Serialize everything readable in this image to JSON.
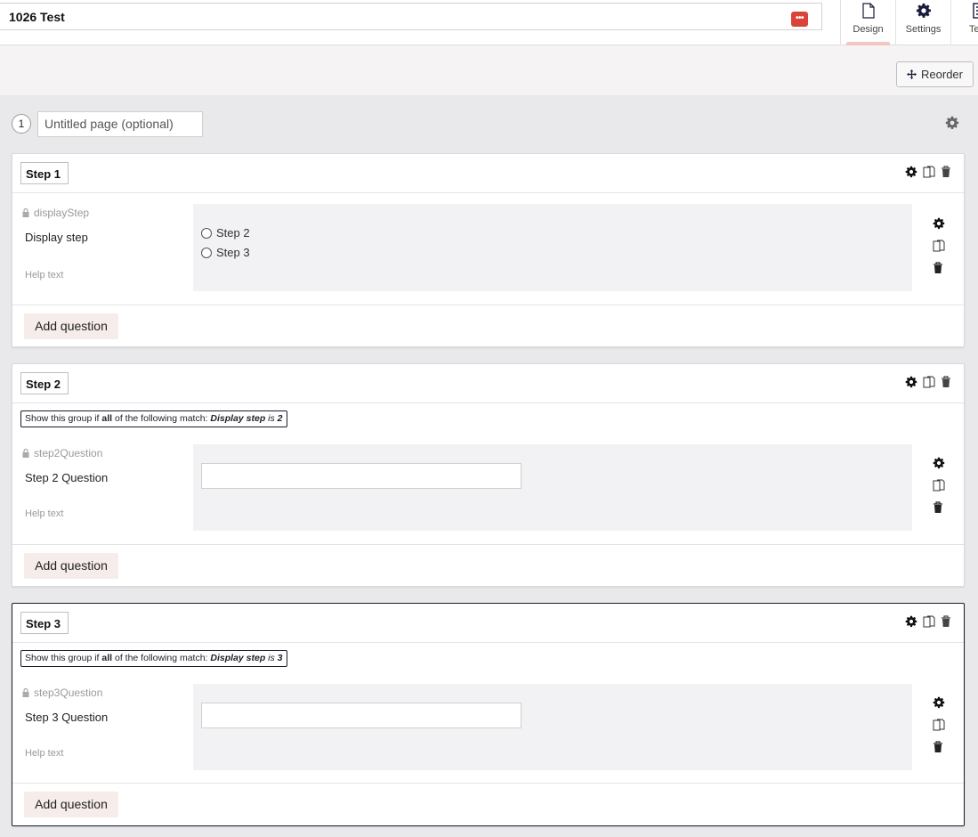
{
  "header": {
    "form_title": "1026 Test",
    "tabs": [
      {
        "label": "Design",
        "icon": "document-icon",
        "active": true
      },
      {
        "label": "Settings",
        "icon": "gear-icon",
        "active": false
      },
      {
        "label": "Test",
        "icon": "test-icon",
        "active": false
      }
    ]
  },
  "toolbar": {
    "reorder_label": "Reorder"
  },
  "page": {
    "number": "1",
    "title_placeholder": "Untitled page (optional)"
  },
  "groups": [
    {
      "name": "Step 1",
      "condition": null,
      "question": {
        "key": "displayStep",
        "label": "Display step",
        "help": "Help text",
        "type": "radio",
        "options": [
          "Step 2",
          "Step 3"
        ]
      },
      "add_label": "Add question"
    },
    {
      "name": "Step 2",
      "condition": {
        "prefix": "Show this group if ",
        "keyword": "all",
        "middle": " of the following match: ",
        "field": "Display step",
        "op": " is ",
        "value": "2"
      },
      "question": {
        "key": "step2Question",
        "label": "Step 2 Question",
        "help": "Help text",
        "type": "text"
      },
      "add_label": "Add question"
    },
    {
      "name": "Step 3",
      "condition": {
        "prefix": "Show this group if ",
        "keyword": "all",
        "middle": " of the following match: ",
        "field": "Display step",
        "op": " is ",
        "value": "3"
      },
      "question": {
        "key": "step3Question",
        "label": "Step 3 Question",
        "help": "Help text",
        "type": "text"
      },
      "add_label": "Add question"
    }
  ],
  "colors": {
    "accent": "#d9443a",
    "tab_underline": "#f1c7bf",
    "add_button_bg": "#f6ecea",
    "selected_border": "#1a1a2e"
  }
}
